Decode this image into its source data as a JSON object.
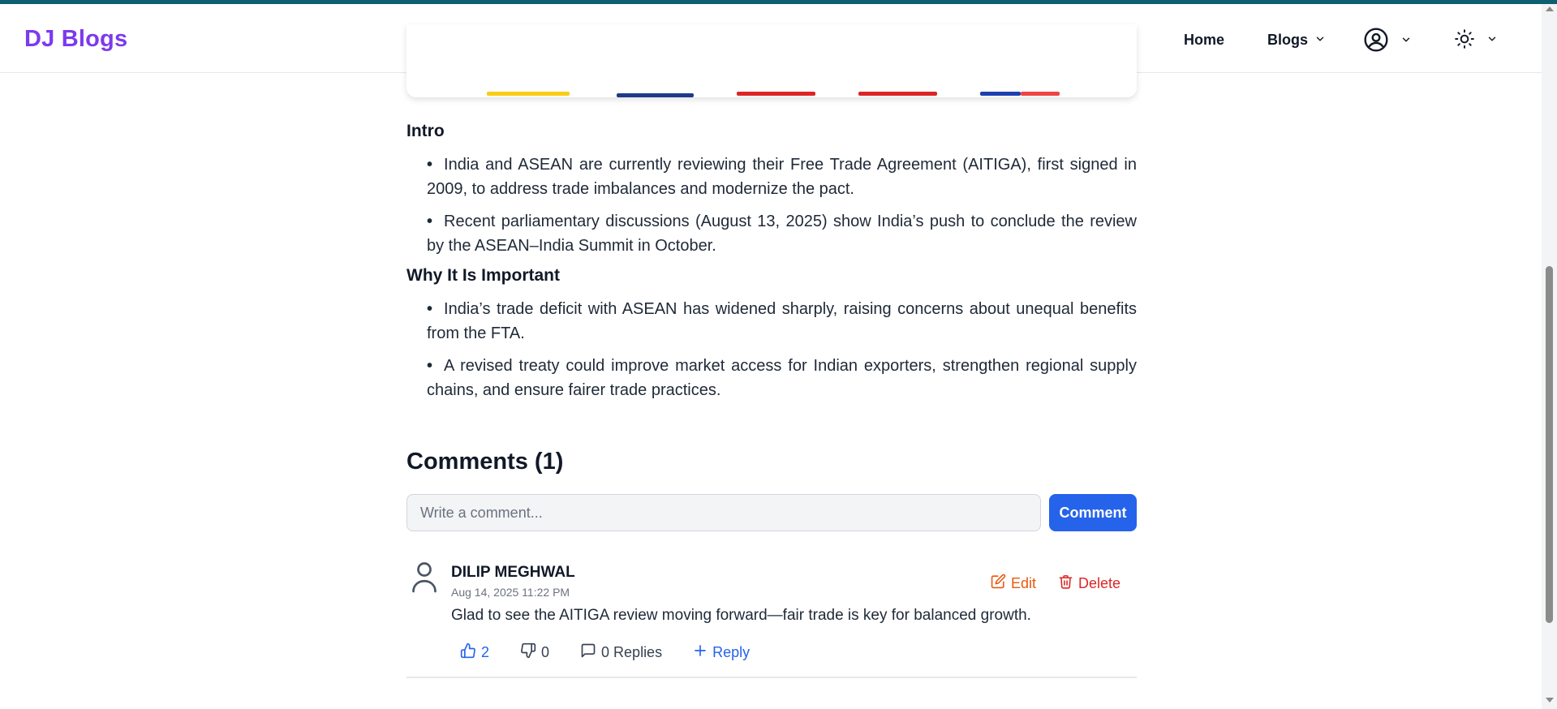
{
  "colors": {
    "brand": "#7c3aed",
    "primary": "#2563eb",
    "edit": "#ea580c",
    "delete": "#dc2626",
    "accent_bar": "#0f5f73"
  },
  "navbar": {
    "brand": "DJ Blogs",
    "home": "Home",
    "blogs": "Blogs",
    "user_icon": "user-circle-icon",
    "theme_icon": "sun-icon"
  },
  "article": {
    "sections": [
      {
        "title": "Intro",
        "bullets": [
          "India and ASEAN are currently reviewing their Free Trade Agreement (AITIGA), first signed in 2009, to address trade imbalances and modernize the pact.",
          "Recent parliamentary discussions (August 13, 2025) show India’s push to conclude the review by the ASEAN–India Summit in October."
        ]
      },
      {
        "title": "Why It Is Important",
        "bullets": [
          "India’s trade deficit with ASEAN has widened sharply, raising concerns about unequal benefits from the FTA.",
          "A revised treaty could improve market access for Indian exporters, strengthen regional supply chains, and ensure fairer trade practices."
        ]
      }
    ]
  },
  "comments": {
    "title": "Comments (1)",
    "input_placeholder": "Write a comment...",
    "submit_label": "Comment",
    "items": [
      {
        "author": "DILIP MEGHWAL",
        "timestamp": "Aug 14, 2025 11:22 PM",
        "text": "Glad to see the AITIGA review moving forward—fair trade is key for balanced growth.",
        "edit_label": "Edit",
        "delete_label": "Delete",
        "likes": "2",
        "dislikes": "0",
        "replies_label": "0 Replies",
        "reply_label": "Reply"
      }
    ]
  }
}
